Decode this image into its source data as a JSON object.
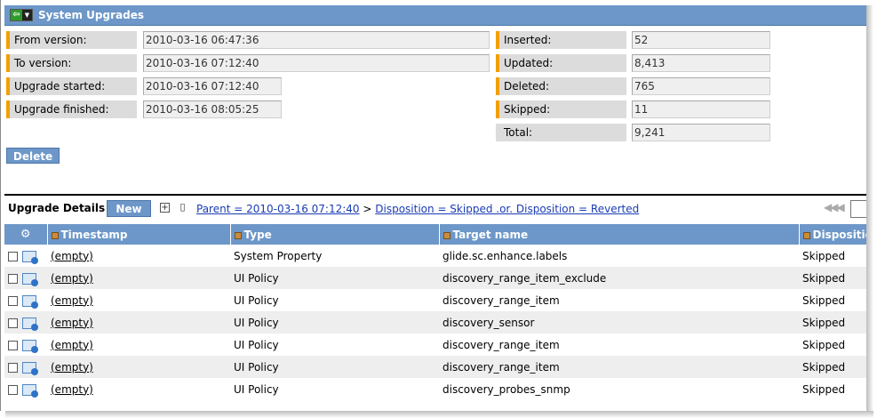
{
  "header": {
    "title": "System Upgrades"
  },
  "fields_left": [
    {
      "label": "From version:",
      "value": "2010-03-16 06:47:36"
    },
    {
      "label": "To version:",
      "value": "2010-03-16 07:12:40"
    },
    {
      "label": "Upgrade started:",
      "value": "2010-03-16 07:12:40"
    },
    {
      "label": "Upgrade finished:",
      "value": "2010-03-16 08:05:25"
    }
  ],
  "fields_right": [
    {
      "label": "Inserted:",
      "value": "52"
    },
    {
      "label": "Updated:",
      "value": "8,413"
    },
    {
      "label": "Deleted:",
      "value": "765"
    },
    {
      "label": "Skipped:",
      "value": "11"
    },
    {
      "label": "Total:",
      "value": "9,241"
    }
  ],
  "actions": {
    "delete_label": "Delete"
  },
  "details": {
    "title": "Upgrade Details",
    "new_label": "New",
    "crumb_parent": "Parent = 2010-03-16 07:12:40",
    "crumb_sep": ">",
    "crumb_filter": "Disposition = Skipped .or. Disposition = Reverted",
    "pager_glyphs": "◀◀◀"
  },
  "table": {
    "columns": [
      "Timestamp",
      "Type",
      "Target name",
      "Disposition"
    ],
    "rows": [
      {
        "timestamp": "(empty)",
        "type": "System Property",
        "target": "glide.sc.enhance.labels",
        "disposition": "Skipped"
      },
      {
        "timestamp": "(empty)",
        "type": "UI Policy",
        "target": "discovery_range_item_exclude",
        "disposition": "Skipped"
      },
      {
        "timestamp": "(empty)",
        "type": "UI Policy",
        "target": "discovery_range_item",
        "disposition": "Skipped"
      },
      {
        "timestamp": "(empty)",
        "type": "UI Policy",
        "target": "discovery_sensor",
        "disposition": "Skipped"
      },
      {
        "timestamp": "(empty)",
        "type": "UI Policy",
        "target": "discovery_range_item",
        "disposition": "Skipped"
      },
      {
        "timestamp": "(empty)",
        "type": "UI Policy",
        "target": "discovery_range_item",
        "disposition": "Skipped"
      },
      {
        "timestamp": "(empty)",
        "type": "UI Policy",
        "target": "discovery_probes_snmp",
        "disposition": "Skipped"
      }
    ]
  },
  "colors": {
    "header_blue": "#6d97c8",
    "mandatory_orange": "#f2a000",
    "link_blue": "#1a3cb4"
  }
}
